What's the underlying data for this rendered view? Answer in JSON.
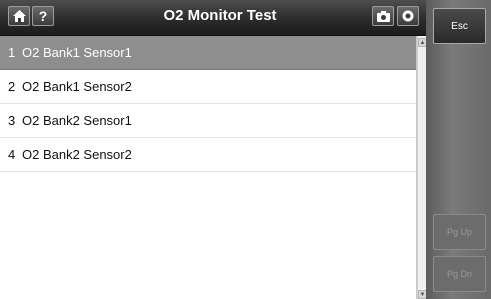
{
  "header": {
    "title": "O2 Monitor Test",
    "home_icon": "home-icon",
    "help_label": "?",
    "camera_icon": "camera-icon",
    "record_icon": "record-icon"
  },
  "list": {
    "items": [
      {
        "num": "1",
        "label": "O2 Bank1 Sensor1",
        "selected": true
      },
      {
        "num": "2",
        "label": "O2 Bank1 Sensor2",
        "selected": false
      },
      {
        "num": "3",
        "label": "O2 Bank2 Sensor1",
        "selected": false
      },
      {
        "num": "4",
        "label": "O2 Bank2 Sensor2",
        "selected": false
      }
    ]
  },
  "panel": {
    "esc_label": "Esc",
    "pgup_label": "Pg Up",
    "pgdn_label": "Pg Dn"
  },
  "colors": {
    "selected_row": "#8e8e8e",
    "titlebar": "#2b2b2b",
    "panel": "#6a6a6a"
  }
}
